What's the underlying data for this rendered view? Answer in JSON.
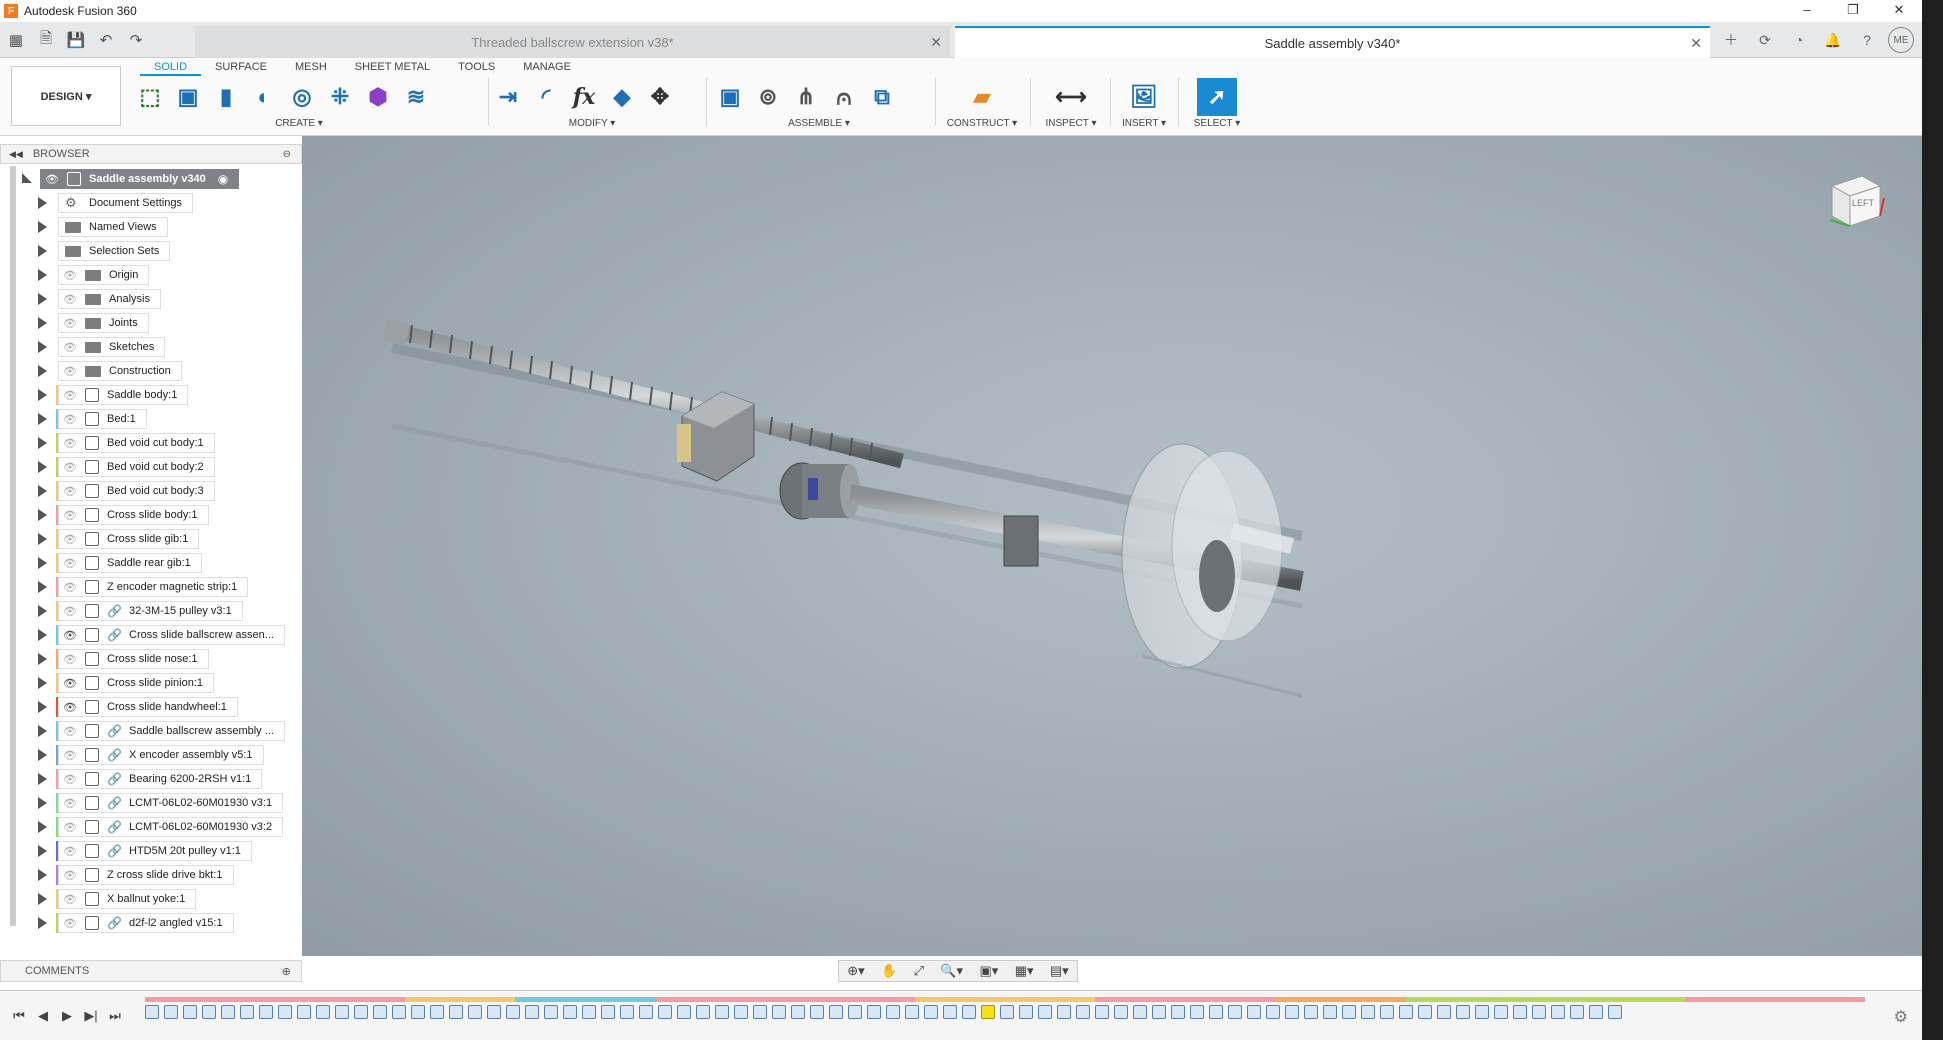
{
  "app": {
    "title": "Autodesk Fusion 360",
    "logo_letter": "F"
  },
  "window_controls": {
    "minimize": "–",
    "restore": "❐",
    "close": "✕"
  },
  "tabs": [
    {
      "label": "Threaded ballscrew extension v38*",
      "active": false
    },
    {
      "label": "Saddle assembly v340*",
      "active": true
    }
  ],
  "user_initials": "ME",
  "workspace": {
    "label": "DESIGN ▾"
  },
  "ribbon_tabs": [
    "SOLID",
    "SURFACE",
    "MESH",
    "SHEET METAL",
    "TOOLS",
    "MANAGE"
  ],
  "ribbon_groups": {
    "create": "CREATE ▾",
    "modify": "MODIFY ▾",
    "assemble": "ASSEMBLE ▾",
    "construct": "CONSTRUCT ▾",
    "inspect": "INSPECT ▾",
    "insert": "INSERT ▾",
    "select": "SELECT ▾"
  },
  "browser": {
    "title": "BROWSER",
    "root": "Saddle assembly v340",
    "items": [
      {
        "label": "Document Settings",
        "kind": "gear",
        "color": ""
      },
      {
        "label": "Named Views",
        "kind": "folder",
        "color": ""
      },
      {
        "label": "Selection Sets",
        "kind": "folder",
        "color": ""
      },
      {
        "label": "Origin",
        "kind": "folder-eye",
        "color": ""
      },
      {
        "label": "Analysis",
        "kind": "folder-eye",
        "color": ""
      },
      {
        "label": "Joints",
        "kind": "folder-eye",
        "color": ""
      },
      {
        "label": "Sketches",
        "kind": "folder-eye",
        "color": ""
      },
      {
        "label": "Construction",
        "kind": "folder-eye",
        "color": ""
      },
      {
        "label": "Saddle body:1",
        "kind": "comp",
        "color": "#f5c96b"
      },
      {
        "label": "Bed:1",
        "kind": "comp",
        "color": "#6fcbe0"
      },
      {
        "label": "Bed void cut body:1",
        "kind": "comp",
        "color": "#b6d957"
      },
      {
        "label": "Bed void cut body:2",
        "kind": "comp",
        "color": "#b6d957"
      },
      {
        "label": "Bed void cut body:3",
        "kind": "comp",
        "color": "#f5c96b"
      },
      {
        "label": "Cross slide body:1",
        "kind": "comp",
        "color": "#f59aa2"
      },
      {
        "label": "Cross slide gib:1",
        "kind": "comp",
        "color": "#f5c96b"
      },
      {
        "label": "Saddle rear gib:1",
        "kind": "comp",
        "color": "#f5c96b"
      },
      {
        "label": "Z encoder magnetic strip:1",
        "kind": "comp",
        "color": "#f59aa2"
      },
      {
        "label": "32-3M-15 pulley v3:1",
        "kind": "link",
        "color": "#f5c96b"
      },
      {
        "label": "Cross slide ballscrew assen...",
        "kind": "link-on",
        "color": "#6fcbe0"
      },
      {
        "label": "Cross slide nose:1",
        "kind": "comp",
        "color": "#f5a95f"
      },
      {
        "label": "Cross slide pinion:1",
        "kind": "comp-on",
        "color": "#f5c96b"
      },
      {
        "label": "Cross slide handwheel:1",
        "kind": "comp-on",
        "color": "#e0563c"
      },
      {
        "label": "Saddle ballscrew assembly ...",
        "kind": "link",
        "color": "#6fcbe0"
      },
      {
        "label": "X encoder assembly v5:1",
        "kind": "link",
        "color": "#6fa3e0"
      },
      {
        "label": "Bearing 6200-2RSH v1:1",
        "kind": "link",
        "color": "#f59aa2"
      },
      {
        "label": "LCMT-06L02-60M01930 v3:1",
        "kind": "link",
        "color": "#7fe07f"
      },
      {
        "label": "LCMT-06L02-60M01930 v3:2",
        "kind": "link",
        "color": "#7fe07f"
      },
      {
        "label": "HTD5M 20t pulley v1:1",
        "kind": "link",
        "color": "#5a6fe0"
      },
      {
        "label": "Z cross slide drive bkt:1",
        "kind": "comp",
        "color": "#b07fe0"
      },
      {
        "label": "X ballnut yoke:1",
        "kind": "comp",
        "color": "#f5c96b"
      },
      {
        "label": "d2f-l2 angled v15:1",
        "kind": "link",
        "color": "#b6d957"
      }
    ]
  },
  "viewcube": {
    "face": "LEFT"
  },
  "comments": {
    "title": "COMMENTS"
  },
  "nav_tools": [
    "⊕▾",
    "✋",
    "⤢",
    "🔍▾",
    "▣▾",
    "▦▾",
    "▤▾"
  ],
  "timeline": {
    "controls": [
      "⏮",
      "◀",
      "▶",
      "▶|",
      "⏭"
    ],
    "feature_count": 78,
    "highlight_index": 44
  }
}
